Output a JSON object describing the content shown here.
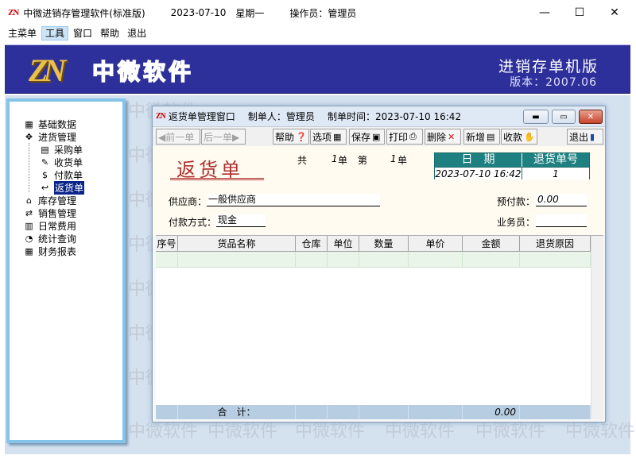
{
  "app": {
    "logo": "ZN",
    "title": "中微进销存管理软件(标准版)",
    "date": "2023-07-10",
    "weekday": "星期一",
    "operator_label": "操作员：管理员",
    "win_controls": [
      "—",
      "☐",
      "✕"
    ]
  },
  "menu": [
    "主菜单",
    "工具",
    "窗口",
    "帮助",
    "退出"
  ],
  "banner": {
    "brand": "中微软件",
    "edition": "进销存单机版",
    "version": "版本：2007.06"
  },
  "watermark": "中微软件",
  "nav": [
    {
      "label": "基础数据",
      "icon": "▦",
      "level": 1
    },
    {
      "label": "进货管理",
      "icon": "✥",
      "level": 1
    },
    {
      "label": "采购单",
      "icon": "▤",
      "level": 2
    },
    {
      "label": "收货单",
      "icon": "✎",
      "level": 2
    },
    {
      "label": "付款单",
      "icon": "$",
      "level": 2
    },
    {
      "label": "返货单",
      "icon": "↩",
      "level": 2,
      "selected": true
    },
    {
      "label": "库存管理",
      "icon": "⌂",
      "level": 1
    },
    {
      "label": "销售管理",
      "icon": "⇄",
      "level": 1
    },
    {
      "label": "日常费用",
      "icon": "▥",
      "level": 1
    },
    {
      "label": "统计查询",
      "icon": "◔",
      "level": 1
    },
    {
      "label": "财务报表",
      "icon": "▦",
      "level": 1
    }
  ],
  "window": {
    "logo": "ZN",
    "title": "返货单管理窗口",
    "maker": "制单人：管理员",
    "time": "制单时间：2023-07-10 16:42"
  },
  "toolbar": {
    "prev": "◀前一单",
    "next": "后一单▶",
    "help": "帮助",
    "options": "选项",
    "save": "保存",
    "print": "打印",
    "delete": "删除",
    "new": "新增",
    "collapse": "收款",
    "exit": "退出"
  },
  "form": {
    "doc_title": "返货单",
    "total_label": "共",
    "total_count": "1",
    "unit1": "单",
    "page_label": "第",
    "page_num": "1",
    "unit2": "单",
    "date_header": "日　期",
    "no_header": "退货单号",
    "date_value": "2023-07-10 16:42",
    "no_value": "1",
    "supplier_label": "供应商：",
    "supplier_value": "一般供应商",
    "prepay_label": "预付款：",
    "prepay_value": "0.00",
    "paymethod_label": "付款方式：",
    "paymethod_value": "现金",
    "clerk_label": "业务员：",
    "clerk_value": ""
  },
  "grid": {
    "columns": [
      "序号",
      "货品名称",
      "仓库",
      "单位",
      "数量",
      "单价",
      "金额",
      "退货原因"
    ],
    "total_label": "合　计：",
    "total_amount": "0.00"
  }
}
